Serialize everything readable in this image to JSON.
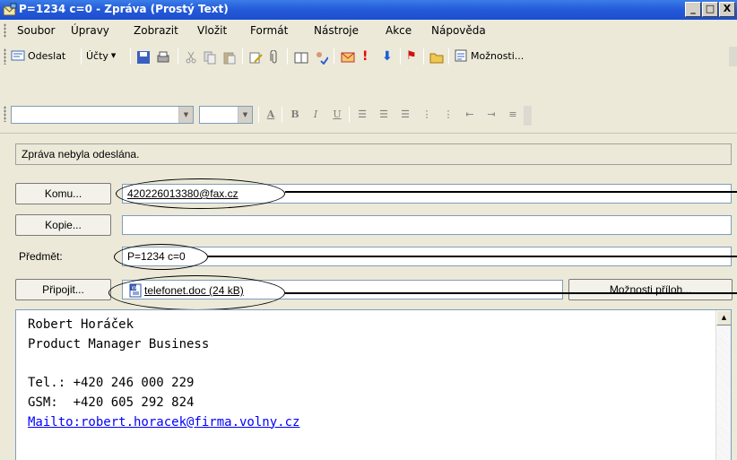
{
  "window": {
    "title": "P=1234 c=0 - Zpráva (Prostý Text)",
    "min": "_",
    "max": "□",
    "close": "X"
  },
  "menu": [
    "Soubor",
    "Úpravy",
    "Zobrazit",
    "Vložit",
    "Formát",
    "Nástroje",
    "Akce",
    "Nápověda"
  ],
  "toolbar": {
    "send": "Odeslat",
    "accounts": "Účty",
    "options": "Možnosti..."
  },
  "format": {
    "bold": "B",
    "italic": "I",
    "underline": "U",
    "color": "A"
  },
  "info": "Zpráva nebyla odeslána.",
  "header": {
    "to_button": "Komu...",
    "to_value": "420226013380@fax.cz",
    "cc_button": "Kopie...",
    "cc_value": "",
    "subject_label": "Předmět:",
    "subject_value": "P=1234 c=0",
    "attach_button": "Připojit...",
    "attachment": "telefonet.doc (24 kB)",
    "attach_options": "Možnosti příloh..."
  },
  "body": {
    "line1": "Robert Horáček",
    "line2": "Product Manager Business",
    "line3": "",
    "line4": "Tel.: +420 246 000 229",
    "line5": "GSM:  +420 605 292 824",
    "link": "Mailto:robert.horacek@firma.volny.cz"
  },
  "colors": {
    "titlebar": "#2459d8",
    "link": "#0000ff"
  }
}
